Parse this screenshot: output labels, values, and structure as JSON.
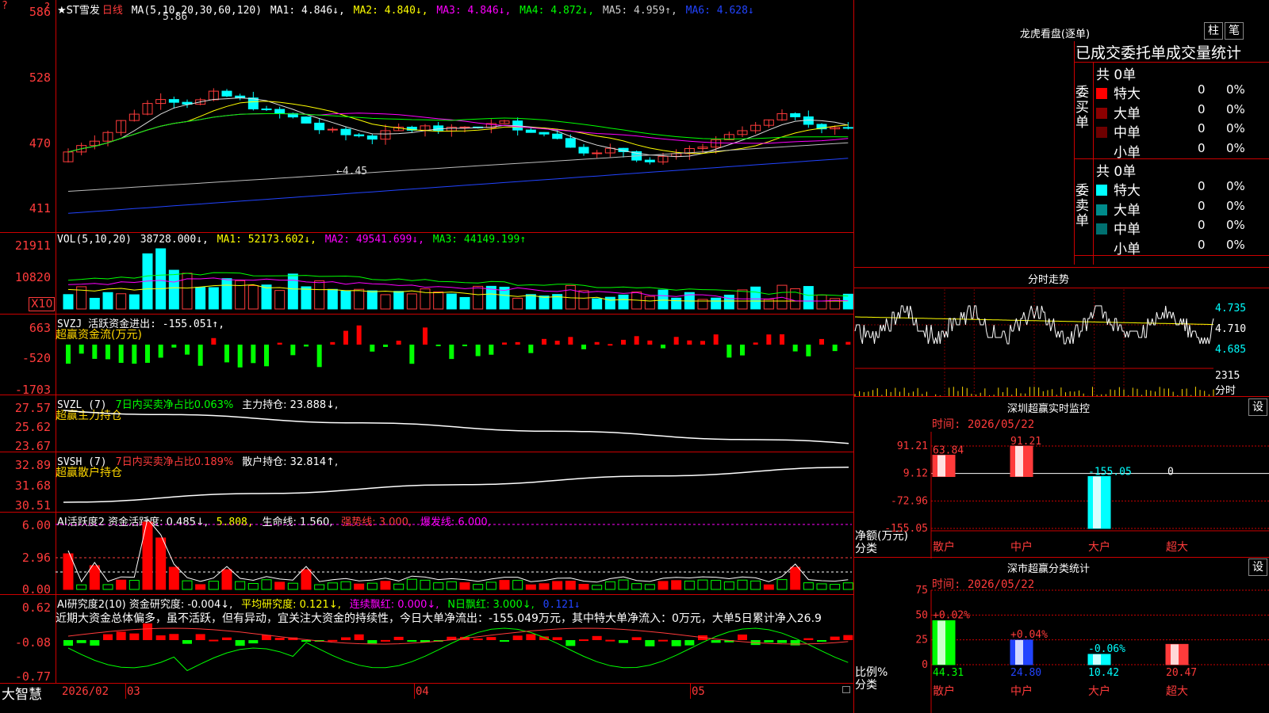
{
  "header": {
    "stock_name": "★ST雪发",
    "period": "日线",
    "ma_params": "MA(5,10,20,30,60,120)",
    "ma1": "MA1: 4.846↓,",
    "ma2": "MA2: 4.840↓,",
    "ma3": "MA3: 4.846↓,",
    "ma4": "MA4: 4.872↓,",
    "ma5": "MA5: 4.959↑,",
    "ma6": "MA6: 4.628↓",
    "corner_mark": "?"
  },
  "price_axis": [
    "586",
    "528",
    "470",
    "411"
  ],
  "price_annotations": {
    "high": "5.86",
    "low": "←4.45"
  },
  "vol_panel": {
    "title": "VOL(5,10,20)",
    "value": "38728.000↓,",
    "ma1": "MA1: 52173.602↓,",
    "ma2": "MA2: 49541.699↓,",
    "ma3": "MA3: 44149.199↑",
    "axis": [
      "21911",
      "10820",
      "X10"
    ]
  },
  "svzj_panel": {
    "title": "SVZJ  活跃资金进出: -155.051↑,",
    "sub": "超赢资金流(万元)",
    "axis": [
      "663",
      "-520",
      "-1703"
    ]
  },
  "svzl_panel": {
    "title_a": "SVZL (7)",
    "title_b": "7日内买卖净占比0.063%",
    "title_c": "主力持仓: 23.888↓,",
    "sub": "超赢主力持仓",
    "axis": [
      "27.57",
      "25.62",
      "23.67"
    ]
  },
  "svsh_panel": {
    "title_a": "SVSH (7)",
    "title_b": "7日内买卖净占比0.189%",
    "title_c": "散户持仓: 32.814↑,",
    "sub": "超赢散户持仓",
    "axis": [
      "32.89",
      "31.68",
      "30.51"
    ]
  },
  "ai_active_panel": {
    "t1": "AI活跃度2 资金活跃度: 0.485↓,",
    "t2": "5.808,",
    "t3": "生命线: 1.560,",
    "t4": "强势线: 3.000,",
    "t5": "爆发线: 6.000,",
    "axis": [
      "6.00",
      "2.96",
      "0.00"
    ]
  },
  "ai_research_panel": {
    "t1": "AI研究度2(10) 资金研究度: -0.004↓,",
    "t2": "平均研究度: 0.121↓,",
    "t3": "连续飘红: 0.000↓,",
    "t4": "N日飘红: 3.000↓,",
    "t5": "0.121↓",
    "comment": "近期大资金总体偏多，虽不活跃，但有异动，宜关注大资金的持续性，今日大单净流出：-155.049万元，其中特大单净流入：0万元，大单5日累计净入26.9",
    "axis": [
      "0.62",
      "-0.08",
      "-0.77"
    ]
  },
  "bottom_bar": {
    "app_name": "大智慧",
    "date_start": "2026/02",
    "months": [
      "03",
      "04",
      "05"
    ]
  },
  "dragon_tiger": {
    "title": "龙虎看盘(逐单)",
    "btn_bar": "柱",
    "btn_pen": "笔",
    "header": "已成交委托单成交量统计",
    "buy": {
      "label": "委买单",
      "total": "共 0单",
      "rows": [
        {
          "name": "特大",
          "count": "0",
          "pct": "0%",
          "color": "#ff0000"
        },
        {
          "name": "大单",
          "count": "0",
          "pct": "0%",
          "color": "#8b0000"
        },
        {
          "name": "中单",
          "count": "0",
          "pct": "0%",
          "color": "#6e0000"
        },
        {
          "name": "小单",
          "count": "0",
          "pct": "0%",
          "color": "#000000"
        }
      ]
    },
    "sell": {
      "label": "委卖单",
      "total": "共 0单",
      "rows": [
        {
          "name": "特大",
          "count": "0",
          "pct": "0%",
          "color": "#00ffff"
        },
        {
          "name": "大单",
          "count": "0",
          "pct": "0%",
          "color": "#008b8b"
        },
        {
          "name": "中单",
          "count": "0",
          "pct": "0%",
          "color": "#007070"
        },
        {
          "name": "小单",
          "count": "0",
          "pct": "0%",
          "color": "#000000"
        }
      ]
    }
  },
  "intraday": {
    "title": "分时走势",
    "prices": [
      "4.735",
      "4.710",
      "4.685"
    ],
    "vol_label": "2315",
    "vol_unit": "分时"
  },
  "realtime_monitor": {
    "title": "深圳超赢实时监控",
    "btn": "设",
    "time": "时间: 2026/05/22",
    "axis": [
      "91.21",
      "9.12",
      "-72.96",
      "-155.05"
    ],
    "ylabel": "净额(万元)",
    "xlabel": "分类",
    "bars": [
      {
        "cat": "散户",
        "value": 63.84,
        "label": "63.84",
        "color": "#ff3b3b"
      },
      {
        "cat": "中户",
        "value": 91.21,
        "label": "91.21",
        "color": "#ff3b3b"
      },
      {
        "cat": "大户",
        "value": -155.05,
        "label": "-155.05",
        "color": "#00ffff"
      },
      {
        "cat": "超大",
        "value": 0,
        "label": "0",
        "color": "#fff"
      }
    ]
  },
  "classify_stats": {
    "title": "深市超赢分类统计",
    "btn": "设",
    "time": "时间: 2026/05/22",
    "axis": [
      "75",
      "50",
      "25",
      "0"
    ],
    "ylabel": "比例%",
    "xlabel": "分类",
    "bars": [
      {
        "cat": "散户",
        "value": 44.31,
        "label": "44.31",
        "delta": "+0.02%",
        "color": "#00ff00"
      },
      {
        "cat": "中户",
        "value": 24.8,
        "label": "24.80",
        "delta": "+0.04%",
        "color": "#2244ff"
      },
      {
        "cat": "大户",
        "value": 10.42,
        "label": "10.42",
        "delta": "-0.06%",
        "color": "#00ffff"
      },
      {
        "cat": "超大",
        "value": 20.47,
        "label": "20.47",
        "delta": "",
        "color": "#ff3b3b"
      }
    ]
  },
  "chart_data": {
    "type": "bar",
    "title": "深圳超赢实时监控",
    "categories": [
      "散户",
      "中户",
      "大户",
      "超大"
    ],
    "series": [
      {
        "name": "净额(万元)",
        "values": [
          63.84,
          91.21,
          -155.05,
          0
        ]
      },
      {
        "name": "比例%",
        "values": [
          44.31,
          24.8,
          10.42,
          20.47
        ]
      }
    ],
    "ylabel": "净额(万元)"
  }
}
